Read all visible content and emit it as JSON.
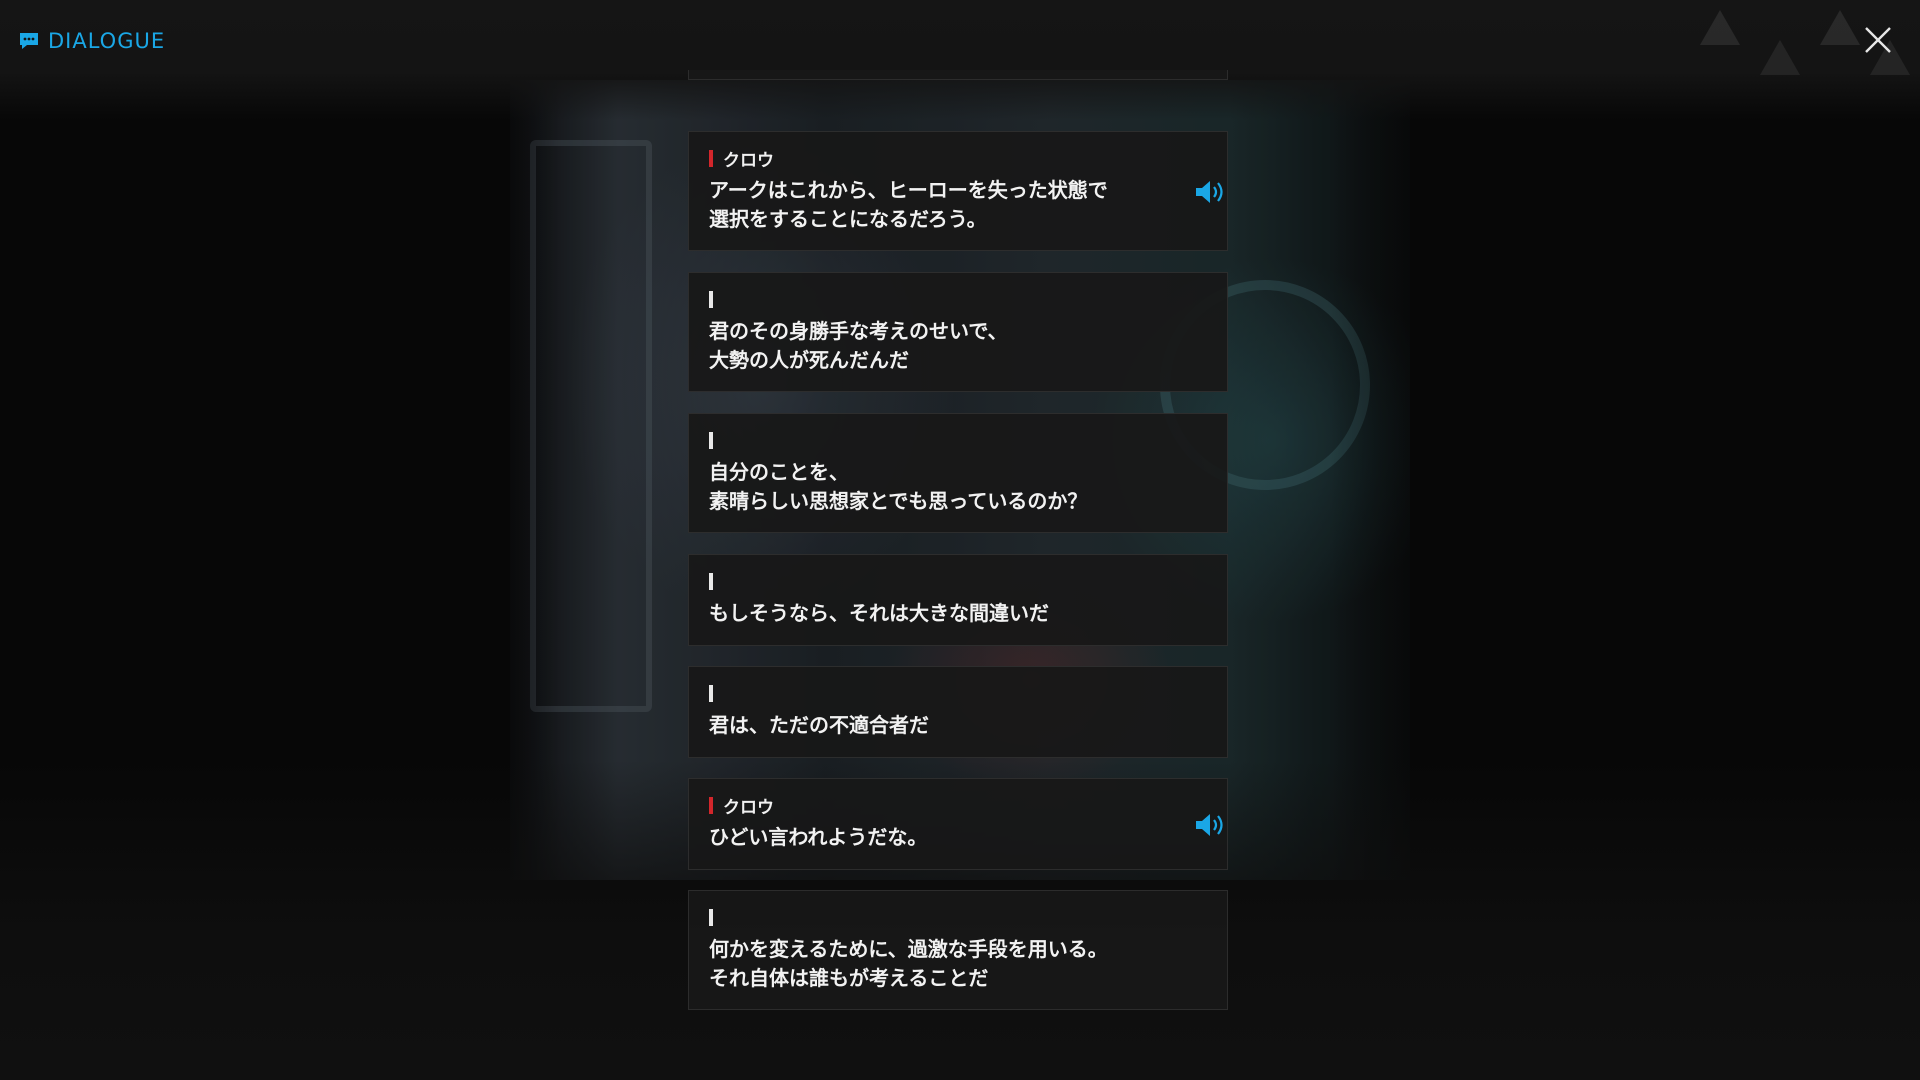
{
  "header": {
    "title": "DIALOGUE",
    "icon": "chat-bubble-icon",
    "close_icon": "close-icon",
    "accent_color": "#1aa7e6"
  },
  "dialogue": [
    {
      "speaker": "",
      "marker": "white",
      "lines": [
        "……"
      ],
      "voice": false,
      "partial": "top"
    },
    {
      "speaker": "クロウ",
      "marker": "red",
      "lines": [
        "アークはこれから、ヒーローを失った状態で",
        "選択をすることになるだろう。"
      ],
      "voice": true
    },
    {
      "speaker": "",
      "marker": "white",
      "lines": [
        "君のその身勝手な考えのせいで、",
        "大勢の人が死んだんだ"
      ],
      "voice": false
    },
    {
      "speaker": "",
      "marker": "white",
      "lines": [
        "自分のことを、",
        "素晴らしい思想家とでも思っているのか？"
      ],
      "voice": false
    },
    {
      "speaker": "",
      "marker": "white",
      "lines": [
        "もしそうなら、それは大きな間違いだ"
      ],
      "voice": false
    },
    {
      "speaker": "",
      "marker": "white",
      "lines": [
        "君は、ただの不適合者だ"
      ],
      "voice": false
    },
    {
      "speaker": "クロウ",
      "marker": "red",
      "lines": [
        "ひどい言われようだな。"
      ],
      "voice": true
    },
    {
      "speaker": "",
      "marker": "white",
      "lines": [
        "何かを変えるために、過激な手段を用いる。",
        "それ自体は誰もが考えることだ"
      ],
      "voice": false
    }
  ],
  "colors": {
    "speaker_marker_red": "#d3262b",
    "speaker_marker_white": "#e8e8e8",
    "voice_icon": "#1aa7e6",
    "card_bg": "#181818"
  }
}
